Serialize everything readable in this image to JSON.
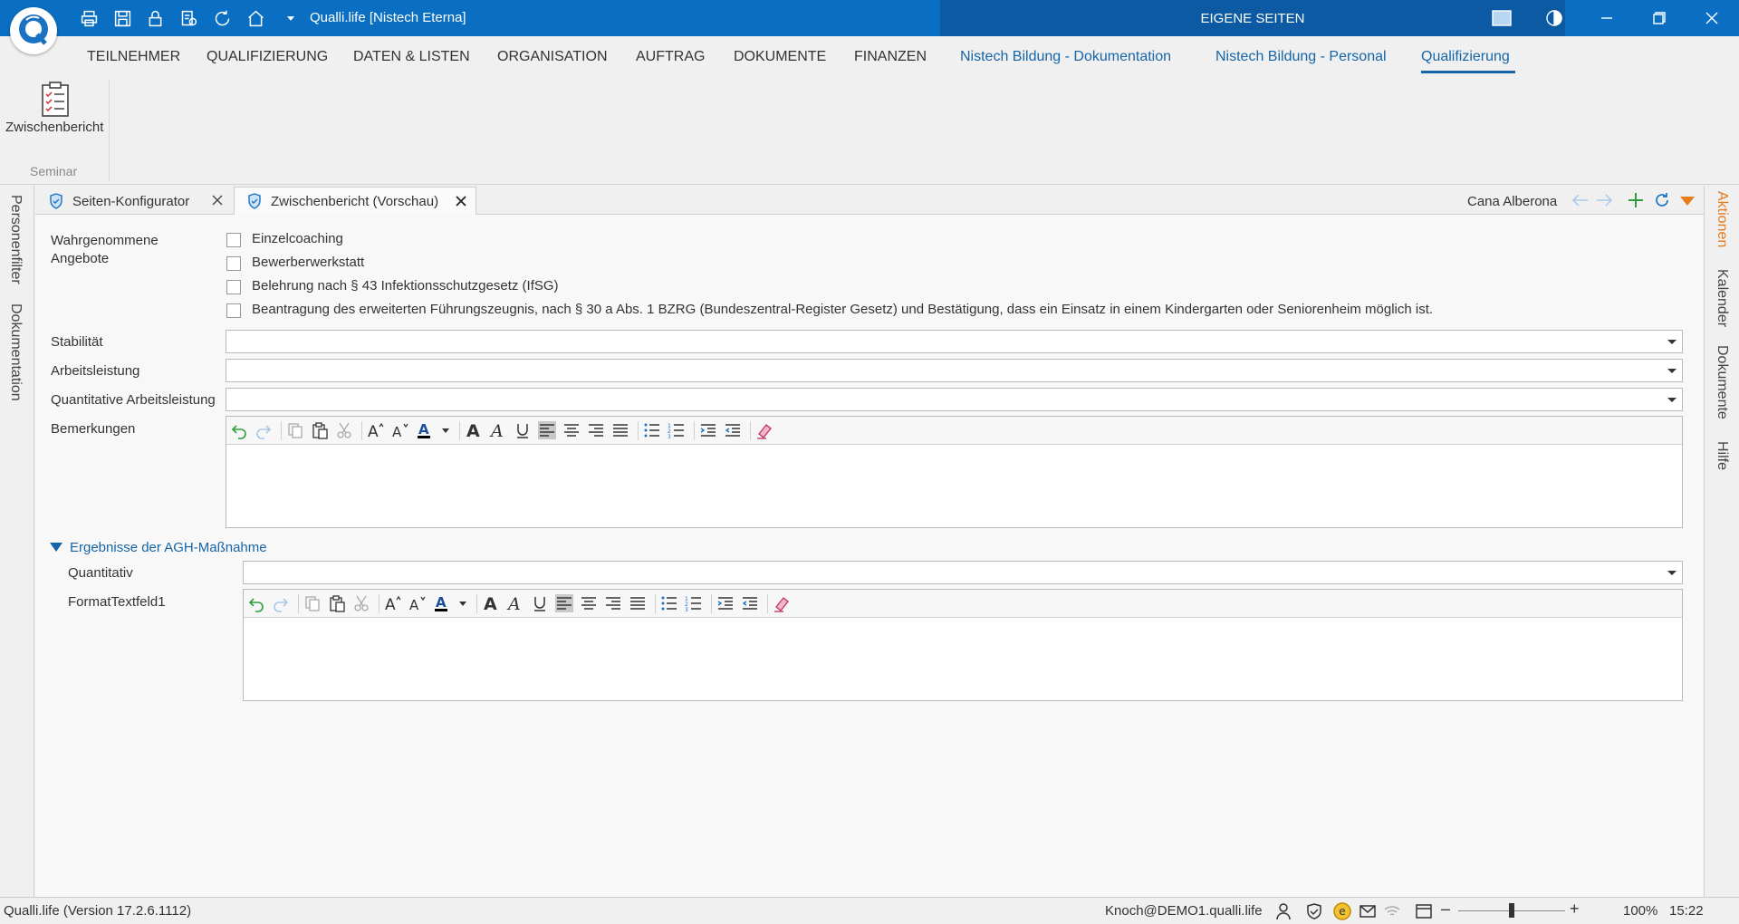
{
  "titlebar": {
    "app_title": "Qualli.life [Nistech Eterna]",
    "eigene_seiten": "EIGENE SEITEN"
  },
  "ribbon": {
    "tabs": [
      {
        "label": "TEILNEHMER"
      },
      {
        "label": "QUALIFIZIERUNG"
      },
      {
        "label": "DATEN & LISTEN"
      },
      {
        "label": "ORGANISATION"
      },
      {
        "label": "AUFTRAG"
      },
      {
        "label": "DOKUMENTE"
      },
      {
        "label": "FINANZEN"
      },
      {
        "label": "Nistech Bildung - Dokumentation"
      },
      {
        "label": "Nistech Bildung - Personal"
      },
      {
        "label": "Qualifizierung"
      }
    ],
    "group": {
      "button_label": "Zwischenbericht",
      "group_label": "Seminar"
    }
  },
  "left_rail": {
    "items": [
      "Personenfilter",
      "Dokumentation"
    ]
  },
  "right_rail": {
    "items": [
      "Aktionen",
      "Kalender",
      "Dokumente",
      "Hilfe"
    ]
  },
  "doc_tabs": [
    {
      "label": "Seiten-Konfigurator"
    },
    {
      "label": "Zwischenbericht (Vorschau)"
    }
  ],
  "doc_toolbar": {
    "person": "Cana Alberona"
  },
  "form": {
    "angebote_label_1": "Wahrgenommene",
    "angebote_label_2": "Angebote",
    "checkboxes": [
      {
        "label": "Einzelcoaching",
        "checked": false
      },
      {
        "label": "Bewerberwerkstatt",
        "checked": false
      },
      {
        "label": "Belehrung nach § 43 Infektionsschutzgesetz (IfSG)",
        "checked": false
      },
      {
        "label": "Beantragung des erweiterten Führungszeugnis, nach § 30 a Abs. 1 BZRG (Bundeszentral-Register Gesetz) und Bestätigung, dass ein Einsatz in einem Kindergarten oder Seniorenheim möglich ist.",
        "checked": false
      }
    ],
    "stabilitaet_label": "Stabilität",
    "stabilitaet_value": "",
    "arbeitsleistung_label": "Arbeitsleistung",
    "arbeitsleistung_value": "",
    "quant_arbeitsleistung_label": "Quantitative Arbeitsleistung",
    "quant_arbeitsleistung_value": "",
    "bemerkungen_label": "Bemerkungen",
    "bemerkungen_value": "",
    "section_title": "Ergebnisse der AGH-Maßnahme",
    "quantitativ_label": "Quantitativ",
    "quantitativ_value": "",
    "formattextfeld_label": "FormatTextfeld1",
    "formattextfeld_value": ""
  },
  "statusbar": {
    "version": "Qualli.life (Version 17.2.6.1112)",
    "user": "Knoch@DEMO1.qualli.life",
    "zoom": "100%",
    "time": "15:22",
    "zoom_level": 0.5
  },
  "colors": {
    "titlebar": "#0a6fc2",
    "eigene_bg": "#0b5aa3",
    "accent_blue": "#1565a8",
    "accent_orange": "#e57c1e",
    "green": "#2e9e3e"
  }
}
